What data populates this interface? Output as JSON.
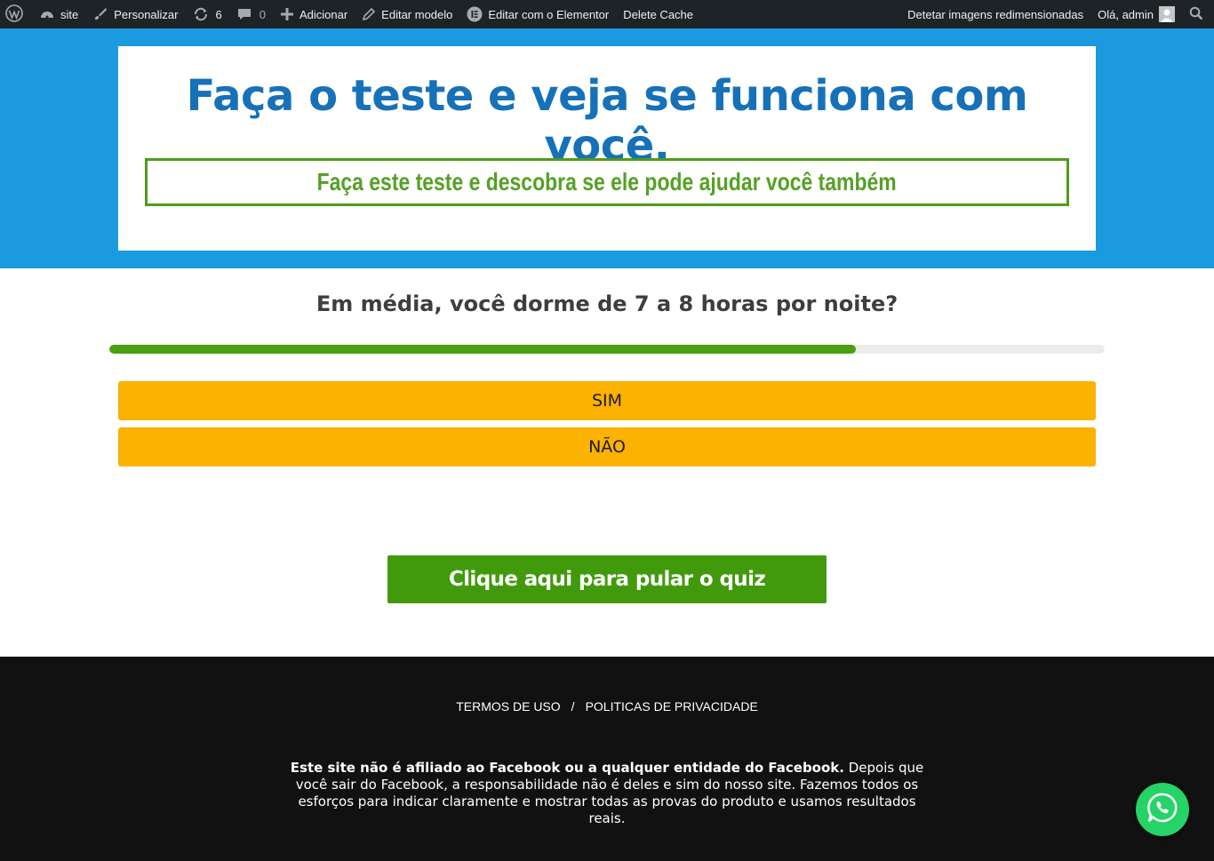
{
  "adminbar": {
    "site_label": "site",
    "customize_label": "Personalizar",
    "updates_count": "6",
    "comments_count": "0",
    "add_label": "Adicionar",
    "edit_template_label": "Editar modelo",
    "elementor_label": "Editar com o Elementor",
    "delete_cache_label": "Delete Cache",
    "detect_images_label": "Detetar imagens redimensionadas",
    "greeting": "Olá, admin"
  },
  "hero": {
    "title": "Faça o teste e veja se funciona com você.",
    "subtitle": "Faça este teste e descobra se ele pode ajudar você também"
  },
  "quiz": {
    "question": "Em média, você dorme de 7 a 8 horas por noite?",
    "progress_fraction": 0.75,
    "answers": [
      "SIM",
      "NÃO"
    ],
    "skip_label": "Clique aqui para pular o quiz"
  },
  "footer": {
    "terms_label": "TERMOS DE USO",
    "separator": "/",
    "privacy_label": "POLITICAS DE PRIVACIDADE",
    "disclaimer_bold": "Este site não é afiliado ao Facebook ou a qualquer entidade do Facebook.",
    "disclaimer_rest": " Depois que você sair do Facebook, a responsabilidade não é deles e sim do nosso site. Fazemos todos os esforços para indicar claramente e mostrar todas as provas do produto e usamos resultados reais."
  },
  "colors": {
    "admin_bg": "#1d2327",
    "hero_bg": "#1b9ae0",
    "title_blue": "#1771b8",
    "accent_green": "#4b9e10",
    "answer_yellow": "#fbb200",
    "footer_bg": "#111111",
    "whatsapp_green": "#25d366"
  },
  "icons": [
    "wordpress-logo-icon",
    "dashboard-icon",
    "brush-icon",
    "updates-icon",
    "comment-icon",
    "plus-icon",
    "pencil-icon",
    "elementor-icon",
    "avatar-icon",
    "search-icon",
    "whatsapp-icon"
  ]
}
